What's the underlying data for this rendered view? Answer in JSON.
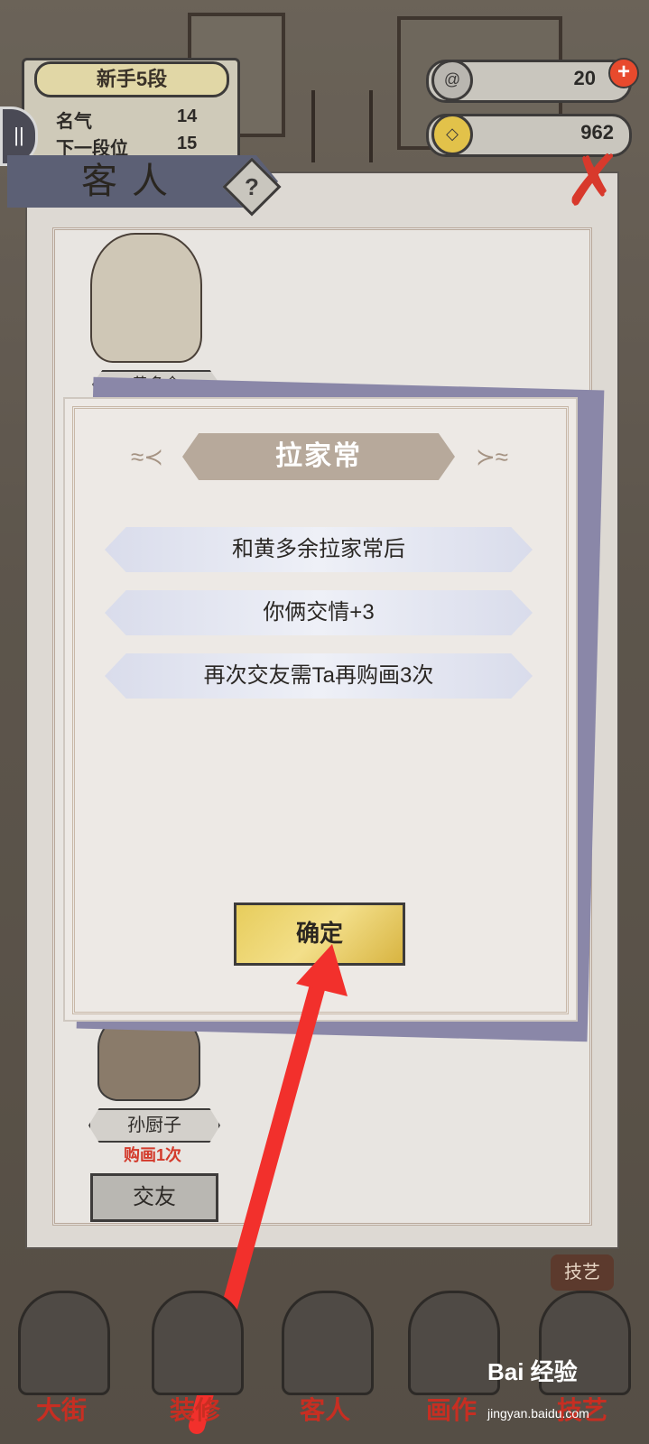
{
  "hud": {
    "rank_title": "新手5段",
    "fame_label": "名气",
    "fame_value": "14",
    "next_label": "下一段位",
    "next_value": "15",
    "energy_value": "20",
    "coins_value": "962",
    "plus_label": "+"
  },
  "panel": {
    "title": "客人",
    "help_label": "?",
    "close_label": "✗"
  },
  "guest_top": {
    "name": "黄多余"
  },
  "guest_bottom": {
    "name": "孙厨子",
    "purchase_count": "购画1次",
    "befriend_button": "交友"
  },
  "dialog": {
    "title": "拉家常",
    "lines": [
      "和黄多余拉家常后",
      "你俩交情+3",
      "再次交友需Ta再购画3次"
    ],
    "confirm_button": "确定"
  },
  "nav": {
    "items": [
      {
        "label": "大街"
      },
      {
        "label": "装修"
      },
      {
        "label": "客人"
      },
      {
        "label": "画作"
      },
      {
        "label": "技艺"
      }
    ],
    "skill_badge": "技艺"
  },
  "watermark": {
    "brand": "Bai 经验",
    "url": "jingyan.baidu.com"
  },
  "colors": {
    "accent_red": "#d8392c",
    "confirm_gold": "#e7cd5c",
    "arrow_red": "#f2302c"
  }
}
